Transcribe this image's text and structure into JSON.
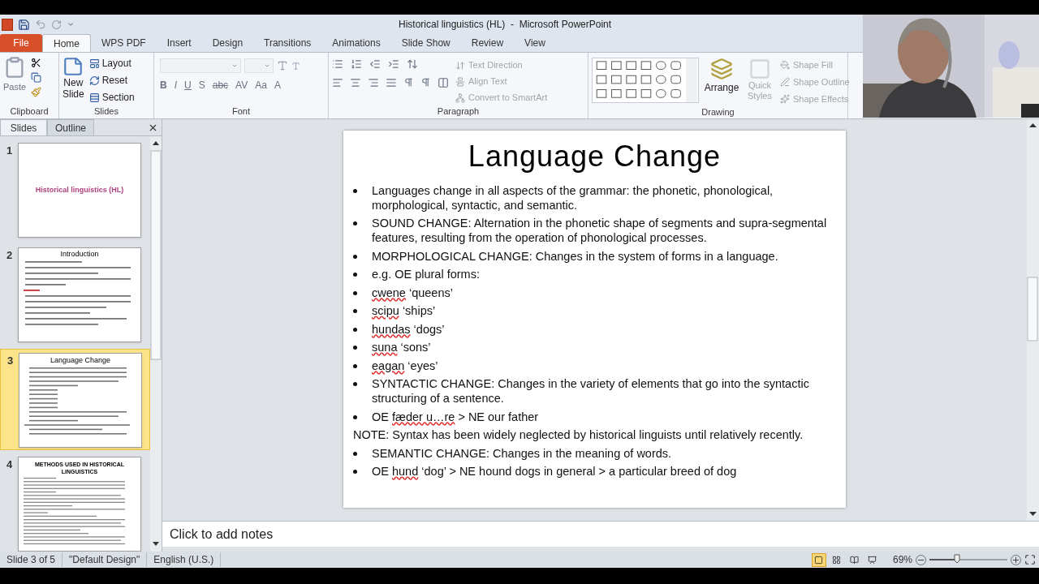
{
  "window": {
    "title": "Historical linguistics (HL)  -  Microsoft PowerPoint"
  },
  "tabs": [
    {
      "label": "File",
      "kind": "file",
      "selected": false
    },
    {
      "label": "Home",
      "kind": "tab",
      "selected": true
    },
    {
      "label": "WPS PDF",
      "kind": "tab",
      "selected": false
    },
    {
      "label": "Insert",
      "kind": "tab",
      "selected": false
    },
    {
      "label": "Design",
      "kind": "tab",
      "selected": false
    },
    {
      "label": "Transitions",
      "kind": "tab",
      "selected": false
    },
    {
      "label": "Animations",
      "kind": "tab",
      "selected": false
    },
    {
      "label": "Slide Show",
      "kind": "tab",
      "selected": false
    },
    {
      "label": "Review",
      "kind": "tab",
      "selected": false
    },
    {
      "label": "View",
      "kind": "tab",
      "selected": false
    }
  ],
  "ribbon": {
    "clipboard": {
      "label": "Clipboard",
      "paste": "Paste"
    },
    "slides": {
      "label": "Slides",
      "new_slide": [
        "New",
        "Slide"
      ],
      "items": [
        "Layout",
        "Reset",
        "Section"
      ]
    },
    "font": {
      "label": "Font",
      "buttons": [
        "B",
        "I",
        "U",
        "S",
        "abc",
        "AV",
        "Aa",
        "A"
      ]
    },
    "paragraph": {
      "label": "Paragraph",
      "items": [
        {
          "label": "Text Direction",
          "disabled": true
        },
        {
          "label": "Align Text",
          "disabled": true
        },
        {
          "label": "Convert to SmartArt",
          "disabled": true
        }
      ]
    },
    "drawing": {
      "label": "Drawing",
      "arrange": "Arrange",
      "quick_styles": {
        "label": "Quick Styles",
        "disabled": true
      },
      "items": [
        {
          "label": "Shape Fill",
          "disabled": true
        },
        {
          "label": "Shape Outline",
          "disabled": true
        },
        {
          "label": "Shape Effects",
          "disabled": true
        }
      ]
    }
  },
  "slides_pane": {
    "tabs": [
      {
        "label": "Slides",
        "selected": true
      },
      {
        "label": "Outline",
        "selected": false
      }
    ],
    "slides": [
      {
        "number": "1",
        "selected": false,
        "title": "Historical linguistics (HL)",
        "kind": "title"
      },
      {
        "number": "2",
        "selected": false,
        "title": "Introduction",
        "kind": "text"
      },
      {
        "number": "3",
        "selected": true,
        "title": "Language Change",
        "kind": "lines"
      },
      {
        "number": "4",
        "selected": false,
        "title": "METHODS USED IN HISTORICAL LINGUISTICS",
        "kind": "small"
      }
    ]
  },
  "slide": {
    "title": "Language Change",
    "items": [
      {
        "kind": "bullet",
        "segments": [
          {
            "text": "Languages change in all aspects of the grammar: the phonetic, phonological, morphological, syntactic, and semantic.",
            "flagged": false
          }
        ]
      },
      {
        "kind": "bullet",
        "segments": [
          {
            "text": "SOUND CHANGE: Alternation in the phonetic shape of segments and supra-segmental features, resulting from the operation of phonological processes.",
            "flagged": false
          }
        ]
      },
      {
        "kind": "bullet",
        "segments": [
          {
            "text": "MORPHOLOGICAL CHANGE: Changes in the system of forms in a language.",
            "flagged": false
          }
        ]
      },
      {
        "kind": "bullet",
        "segments": [
          {
            "text": "e.g. OE plural forms:",
            "flagged": false
          }
        ]
      },
      {
        "kind": "bullet",
        "segments": [
          {
            "text": "cwene",
            "flagged": true
          },
          {
            "text": " ‘queens’",
            "flagged": false
          }
        ]
      },
      {
        "kind": "bullet",
        "segments": [
          {
            "text": "scipu",
            "flagged": true
          },
          {
            "text": " ‘ships’",
            "flagged": false
          }
        ]
      },
      {
        "kind": "bullet",
        "segments": [
          {
            "text": "hundas",
            "flagged": true
          },
          {
            "text": " ‘dogs’",
            "flagged": false
          }
        ]
      },
      {
        "kind": "bullet",
        "segments": [
          {
            "text": "suna",
            "flagged": true
          },
          {
            "text": " ‘sons’",
            "flagged": false
          }
        ]
      },
      {
        "kind": "bullet",
        "segments": [
          {
            "text": "eagan",
            "flagged": true
          },
          {
            "text": " ‘eyes’",
            "flagged": false
          }
        ]
      },
      {
        "kind": "bullet",
        "segments": [
          {
            "text": "SYNTACTIC CHANGE: Changes in the variety of elements that go into the syntactic structuring of a sentence.",
            "flagged": false
          }
        ]
      },
      {
        "kind": "bullet",
        "segments": [
          {
            "text": "OE ",
            "flagged": false
          },
          {
            "text": "fæder u…re",
            "flagged": true
          },
          {
            "text": " > NE our father",
            "flagged": false
          }
        ]
      },
      {
        "kind": "note",
        "segments": [
          {
            "text": "NOTE: Syntax has been widely neglected by historical linguists until relatively recently.",
            "flagged": false
          }
        ]
      },
      {
        "kind": "bullet",
        "segments": [
          {
            "text": "SEMANTIC CHANGE: Changes in the meaning of words.",
            "flagged": false
          }
        ]
      },
      {
        "kind": "bullet",
        "segments": [
          {
            "text": "OE ",
            "flagged": false
          },
          {
            "text": "hund",
            "flagged": true
          },
          {
            "text": " ‘dog’ > NE hound dogs in general > a particular breed of dog",
            "flagged": false
          }
        ]
      }
    ]
  },
  "notes": {
    "placeholder": "Click to add notes"
  },
  "status_bar": {
    "slide": "Slide 3 of 5",
    "theme": "\"Default Design\"",
    "language": "English (U.S.)",
    "zoom": "69%",
    "zoom_slider": {
      "level": 0.35
    },
    "views": [
      {
        "selected": true
      },
      {
        "selected": false
      },
      {
        "selected": false
      },
      {
        "selected": false
      }
    ]
  }
}
